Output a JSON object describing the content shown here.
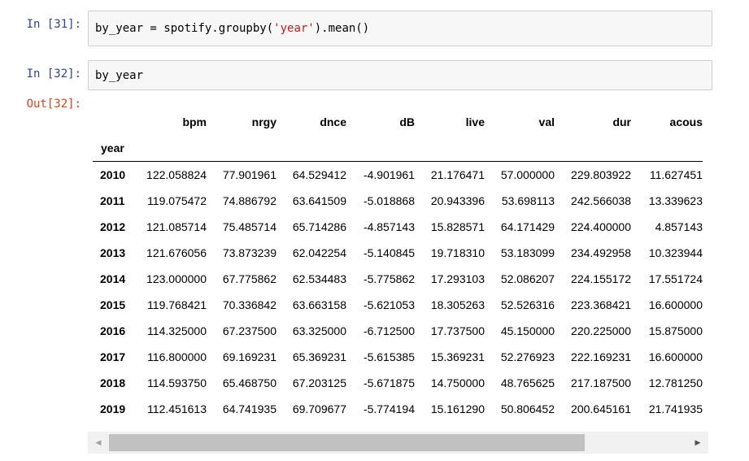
{
  "cells": [
    {
      "prompt": "In [31]:",
      "code_pre": "by_year = spotify.groupby(",
      "code_str": "'year'",
      "code_post": ").mean()"
    },
    {
      "prompt": "In [32]:",
      "code": "by_year"
    }
  ],
  "output": {
    "prompt": "Out[32]:",
    "index_name": "year",
    "columns": [
      "bpm",
      "nrgy",
      "dnce",
      "dB",
      "live",
      "val",
      "dur",
      "acous"
    ],
    "rows": [
      {
        "year": "2010",
        "values": [
          "122.058824",
          "77.901961",
          "64.529412",
          "-4.901961",
          "21.176471",
          "57.000000",
          "229.803922",
          "11.627451"
        ]
      },
      {
        "year": "2011",
        "values": [
          "119.075472",
          "74.886792",
          "63.641509",
          "-5.018868",
          "20.943396",
          "53.698113",
          "242.566038",
          "13.339623"
        ]
      },
      {
        "year": "2012",
        "values": [
          "121.085714",
          "75.485714",
          "65.714286",
          "-4.857143",
          "15.828571",
          "64.171429",
          "224.400000",
          "4.857143"
        ]
      },
      {
        "year": "2013",
        "values": [
          "121.676056",
          "73.873239",
          "62.042254",
          "-5.140845",
          "19.718310",
          "53.183099",
          "234.492958",
          "10.323944"
        ]
      },
      {
        "year": "2014",
        "values": [
          "123.000000",
          "67.775862",
          "62.534483",
          "-5.775862",
          "17.293103",
          "52.086207",
          "224.155172",
          "17.551724"
        ]
      },
      {
        "year": "2015",
        "values": [
          "119.768421",
          "70.336842",
          "63.663158",
          "-5.621053",
          "18.305263",
          "52.526316",
          "223.368421",
          "16.600000"
        ]
      },
      {
        "year": "2016",
        "values": [
          "114.325000",
          "67.237500",
          "63.325000",
          "-6.712500",
          "17.737500",
          "45.150000",
          "220.225000",
          "15.875000"
        ]
      },
      {
        "year": "2017",
        "values": [
          "116.800000",
          "69.169231",
          "65.369231",
          "-5.615385",
          "15.369231",
          "52.276923",
          "222.169231",
          "16.600000"
        ]
      },
      {
        "year": "2018",
        "values": [
          "114.593750",
          "65.468750",
          "67.203125",
          "-5.671875",
          "14.750000",
          "48.765625",
          "217.187500",
          "12.781250"
        ]
      },
      {
        "year": "2019",
        "values": [
          "112.451613",
          "64.741935",
          "69.709677",
          "-5.774194",
          "15.161290",
          "50.806452",
          "200.645161",
          "21.741935"
        ]
      }
    ]
  },
  "scrollbar": {
    "left_arrow": "◀",
    "right_arrow": "▶"
  },
  "colors": {
    "in_prompt": "#303f9f",
    "out_prompt": "#d84315",
    "string": "#ba2121",
    "cell_bg": "#f7f7f7"
  }
}
